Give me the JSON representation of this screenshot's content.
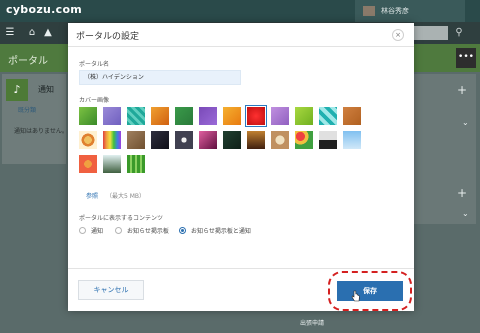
{
  "app": {
    "logo": "cybozu.com",
    "user_name": "林谷秀彦",
    "portal_tab": "ポータル",
    "more_label": "•••"
  },
  "left_panel": {
    "title": "通知",
    "link": "既分類",
    "message": "通知はありません。"
  },
  "bottom_item": "出張申請",
  "modal": {
    "title": "ポータルの設定",
    "close_icon": "×",
    "name_label": "ポータル名",
    "name_value": "（株）ハイデンション",
    "cover_label": "カバー画像",
    "browse_label": "参照",
    "max_size": "（最大5 MB）",
    "content_label": "ポータルに表示するコンテンツ",
    "radio_options": [
      {
        "label": "通知",
        "selected": false
      },
      {
        "label": "お知らせ掲示板",
        "selected": false
      },
      {
        "label": "お知らせ掲示板と通知",
        "selected": true
      }
    ],
    "cancel_label": "キャンセル",
    "save_label": "保存"
  },
  "cover_images": [
    "green-leaves",
    "purple-gradient",
    "teal-pattern",
    "orange-texture",
    "green-diamond",
    "violet-blocks",
    "orange-abstract",
    "red-flower",
    "purple-swirl",
    "lime-pattern",
    "teal-checker",
    "orange-tiles",
    "circle-pattern",
    "rainbow-stripes",
    "brown-texture",
    "dark-night",
    "floral-pattern",
    "pink-abstract",
    "green-dark",
    "brown-gradient",
    "latte-art",
    "colorful-balloons",
    "black-white-landscape",
    "blue-sky",
    "blossom",
    "palm-tree",
    "bamboo-green"
  ],
  "colors": {
    "accent": "#2a6fb0",
    "highlight": "#d42020",
    "portal_green": "#4f7a3e"
  }
}
